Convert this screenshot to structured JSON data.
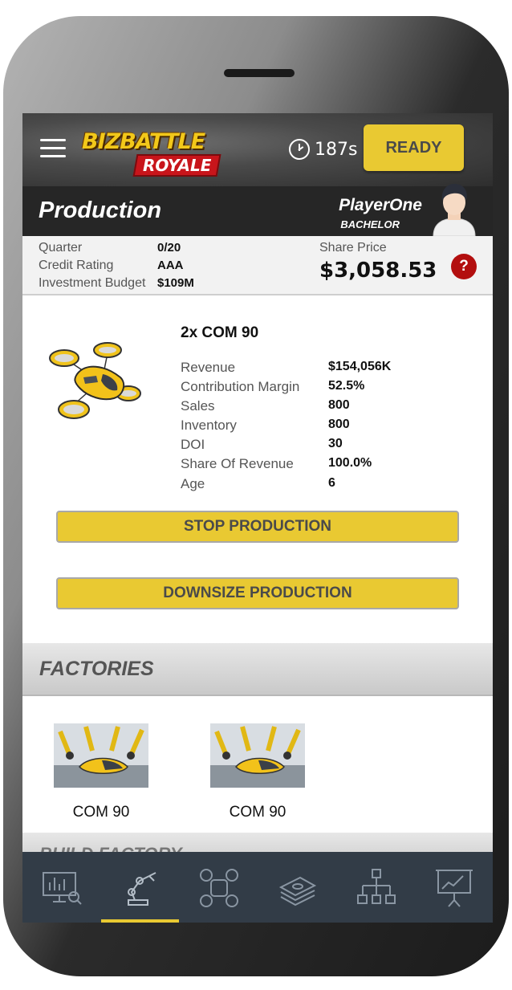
{
  "header": {
    "logo_line1": "BIZBATTLE",
    "logo_line2": "ROYALE",
    "timer": "187s",
    "ready_label": "READY"
  },
  "page": {
    "title": "Production",
    "player_name": "PlayerOne",
    "player_rank": "BACHELOR"
  },
  "stats": {
    "quarter_label": "Quarter",
    "quarter_value": "0/20",
    "credit_label": "Credit Rating",
    "credit_value": "AAA",
    "budget_label": "Investment Budget",
    "budget_value": "$109M",
    "share_label": "Share Price",
    "share_value": "$3,058.53",
    "help": "?"
  },
  "product": {
    "title": "2x COM 90",
    "metrics": [
      {
        "label": "Revenue",
        "value": "$154,056K"
      },
      {
        "label": "Contribution Margin",
        "value": "52.5%"
      },
      {
        "label": "Sales",
        "value": "800"
      },
      {
        "label": "Inventory",
        "value": "800"
      },
      {
        "label": "DOI",
        "value": "30"
      },
      {
        "label": "Share Of Revenue",
        "value": "100.0%"
      },
      {
        "label": "Age",
        "value": "6"
      }
    ],
    "stop_label": "STOP PRODUCTION",
    "downsize_label": "DOWNSIZE PRODUCTION"
  },
  "factories": {
    "title": "FACTORIES",
    "items": [
      {
        "label": "COM 90"
      },
      {
        "label": "COM 90"
      }
    ],
    "next_section_partial": "BUILD FACTORY"
  },
  "nav": {
    "items": [
      "dashboard-chart-icon",
      "robot-arm-icon",
      "drone-icon",
      "money-stack-icon",
      "org-chart-icon",
      "presentation-icon"
    ],
    "active_index": 1
  },
  "colors": {
    "accent": "#e9c932",
    "nav_bg": "#323c47",
    "help_red": "#b30f0f"
  }
}
